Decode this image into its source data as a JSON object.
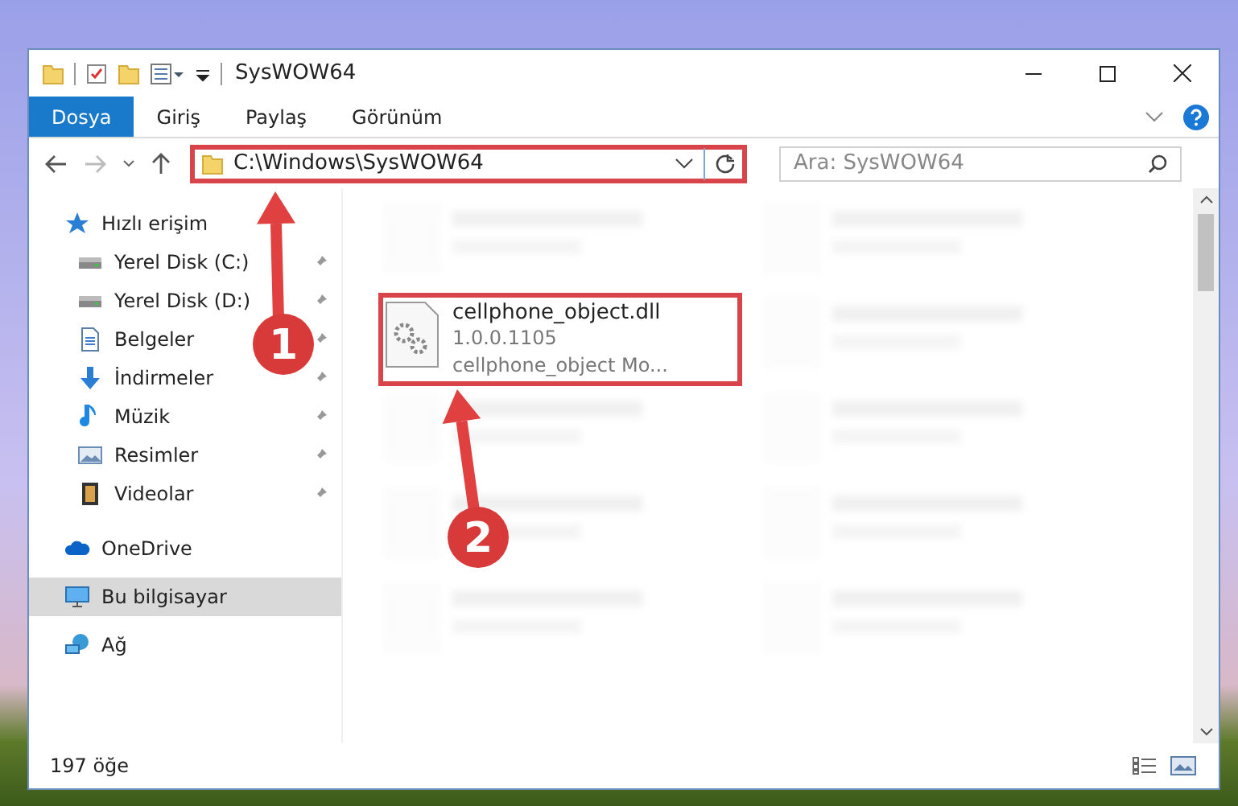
{
  "window": {
    "title": "SysWOW64"
  },
  "ribbon_tabs": [
    {
      "label": "Dosya",
      "selected": true
    },
    {
      "label": "Giriş",
      "selected": false
    },
    {
      "label": "Paylaş",
      "selected": false
    },
    {
      "label": "Görünüm",
      "selected": false
    }
  ],
  "address_bar": {
    "path": "C:\\Windows\\SysWOW64",
    "highlighted": true
  },
  "search": {
    "placeholder": "Ara: SysWOW64"
  },
  "sidebar": {
    "items": [
      {
        "label": "Hızlı erişim",
        "kind": "star",
        "pinned": false,
        "selected": false,
        "children": [
          {
            "label": "Yerel Disk (C:)",
            "kind": "drive",
            "pinned": true,
            "selected": false
          },
          {
            "label": "Yerel Disk (D:)",
            "kind": "drive",
            "pinned": true,
            "selected": false
          },
          {
            "label": "Belgeler",
            "kind": "document",
            "pinned": true,
            "selected": false
          },
          {
            "label": "İndirmeler",
            "kind": "download",
            "pinned": true,
            "selected": false
          },
          {
            "label": "Müzik",
            "kind": "music",
            "pinned": true,
            "selected": false
          },
          {
            "label": "Resimler",
            "kind": "picture",
            "pinned": true,
            "selected": false
          },
          {
            "label": "Videolar",
            "kind": "video",
            "pinned": true,
            "selected": false
          }
        ]
      },
      {
        "label": "OneDrive",
        "kind": "cloud",
        "pinned": false,
        "selected": false
      },
      {
        "label": "Bu bilgisayar",
        "kind": "computer",
        "pinned": false,
        "selected": true
      },
      {
        "label": "Ağ",
        "kind": "network",
        "pinned": false,
        "selected": false
      }
    ]
  },
  "files": [
    {
      "kind": "blurred"
    },
    {
      "kind": "blurred"
    },
    {
      "kind": "highlighted",
      "name": "cellphone_object.dll",
      "lines": [
        "1.0.0.1105",
        "cellphone_object Mo..."
      ]
    },
    {
      "kind": "blurred"
    },
    {
      "kind": "blurred"
    },
    {
      "kind": "blurred"
    },
    {
      "kind": "blurred"
    },
    {
      "kind": "blurred"
    },
    {
      "kind": "blurred"
    },
    {
      "kind": "blurred"
    }
  ],
  "status_bar": {
    "item_count": "197 öğe"
  },
  "annotations": [
    {
      "label": "1"
    },
    {
      "label": "2"
    }
  ]
}
